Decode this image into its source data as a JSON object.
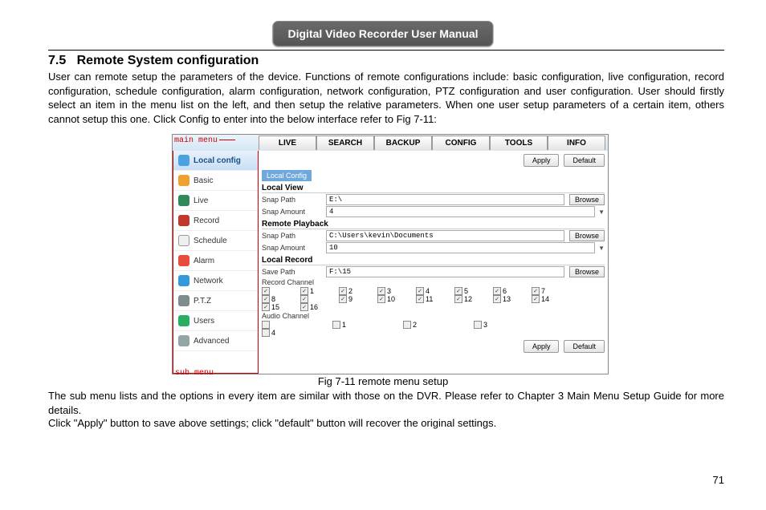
{
  "header": "Digital Video Recorder User Manual",
  "section_number": "7.5",
  "section_title": "Remote System configuration",
  "paragraph1": "User can remote setup the parameters of the device. Functions of remote configurations include: basic configuration, live configuration, record configuration, schedule configuration, alarm configuration, network configuration, PTZ configuration and user configuration. User should firstly select an item in the menu list on the left, and then setup the relative parameters. When one user setup parameters of a certain item, others cannot setup this one. Click Config to enter into the below interface refer to Fig 7-11:",
  "callouts": {
    "main_menu": "main menu",
    "sub_menu": "sub menu"
  },
  "main_tabs": [
    "LIVE",
    "SEARCH",
    "BACKUP",
    "CONFIG",
    "TOOLS",
    "INFO"
  ],
  "sidebar": {
    "items": [
      {
        "label": "Local config",
        "active": true
      },
      {
        "label": "Basic"
      },
      {
        "label": "Live"
      },
      {
        "label": "Record"
      },
      {
        "label": "Schedule"
      },
      {
        "label": "Alarm"
      },
      {
        "label": "Network"
      },
      {
        "label": "P.T.Z"
      },
      {
        "label": "Users"
      },
      {
        "label": "Advanced"
      }
    ]
  },
  "buttons": {
    "apply": "Apply",
    "default": "Default",
    "browse": "Browse"
  },
  "subtab": "Local Config",
  "sections": {
    "local_view": {
      "title": "Local View",
      "snap_path_label": "Snap Path",
      "snap_path_value": "E:\\",
      "snap_amount_label": "Snap Amount",
      "snap_amount_value": "4"
    },
    "remote_playback": {
      "title": "Remote Playback",
      "snap_path_label": "Snap Path",
      "snap_path_value": "C:\\Users\\kevin\\Documents",
      "snap_amount_label": "Snap Amount",
      "snap_amount_value": "10"
    },
    "local_record": {
      "title": "Local Record",
      "save_path_label": "Save Path",
      "save_path_value": "F:\\15",
      "record_channel_label": "Record Channel",
      "channels": [
        "1",
        "2",
        "3",
        "4",
        "5",
        "6",
        "7",
        "8",
        "9",
        "10",
        "11",
        "12",
        "13",
        "14",
        "15",
        "16"
      ],
      "audio_channel_label": "Audio Channel",
      "audio_channels": [
        "1",
        "2",
        "3",
        "4"
      ]
    }
  },
  "caption": "Fig 7-11 remote menu setup",
  "paragraph2": "The sub menu lists and the options in every item are similar with those on the DVR. Please refer to Chapter 3 Main Menu Setup Guide for more details.",
  "paragraph3": "Click \"Apply\" button to save above settings; click \"default\" button will recover the original settings.",
  "page_number": "71"
}
